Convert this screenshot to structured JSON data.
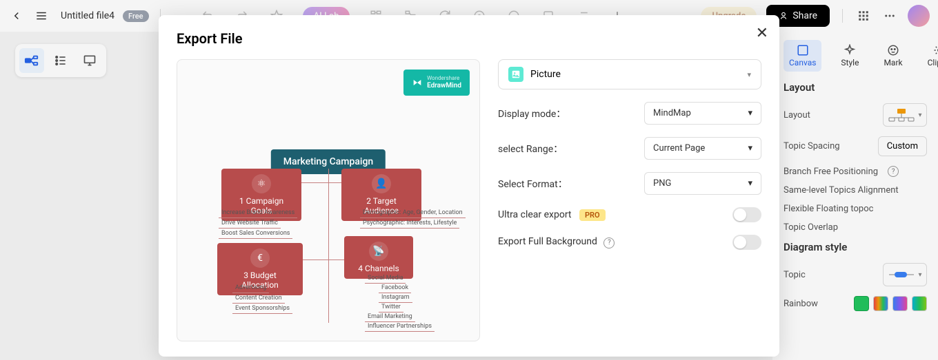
{
  "topbar": {
    "file_title": "Untitled file4",
    "free_badge": "Free",
    "ai_button": "AI Lab",
    "upgrade": "Upgrade",
    "share": "Share"
  },
  "right_panel": {
    "tabs": [
      "Canvas",
      "Style",
      "Mark",
      "Clipart"
    ],
    "layout_title": "Layout",
    "layout_label": "Layout",
    "spacing_label": "Topic Spacing",
    "custom_btn": "Custom",
    "branch_free": "Branch Free Positioning",
    "same_level": "Same-level Topics Alignment",
    "flexible": "Flexible Floating topoc",
    "overlap": "Topic Overlap",
    "diagram_style": "Diagram style",
    "topic_label": "Topic",
    "rainbow_label": "Rainbow"
  },
  "modal": {
    "title": "Export File",
    "picture": "Picture",
    "display_mode_label": "Display mode：",
    "display_mode_value": "MindMap",
    "range_label": "select Range：",
    "range_value": "Current Page",
    "format_label": "Select Format：",
    "format_value": "PNG",
    "ultra_label": "Ultra clear export",
    "pro": "PRO",
    "full_bg_label": "Export Full Background"
  },
  "preview": {
    "badge_top": "Wondershare",
    "badge_bottom": "EdrawMind",
    "root": "Marketing Campaign",
    "node1": "Campaign Goals",
    "node1_subs": [
      "Increase Brand Awareness",
      "Drive Website Traffic",
      "Boost Sales Conversions"
    ],
    "node2": "Target Audience",
    "node2_subs": [
      "Demographic: Age, Gender, Location",
      "Psychographic: Interests, Lifestyle"
    ],
    "node3": "Budget Allocation",
    "node3_subs": [
      "Advertising",
      "Content Creation",
      "Event Sponsorships"
    ],
    "node4": "Channels",
    "node4_subs": [
      "Social Media",
      "Facebook",
      "Instagram",
      "Twitter",
      "Email Marketing",
      "Influencer Partnerships"
    ]
  }
}
